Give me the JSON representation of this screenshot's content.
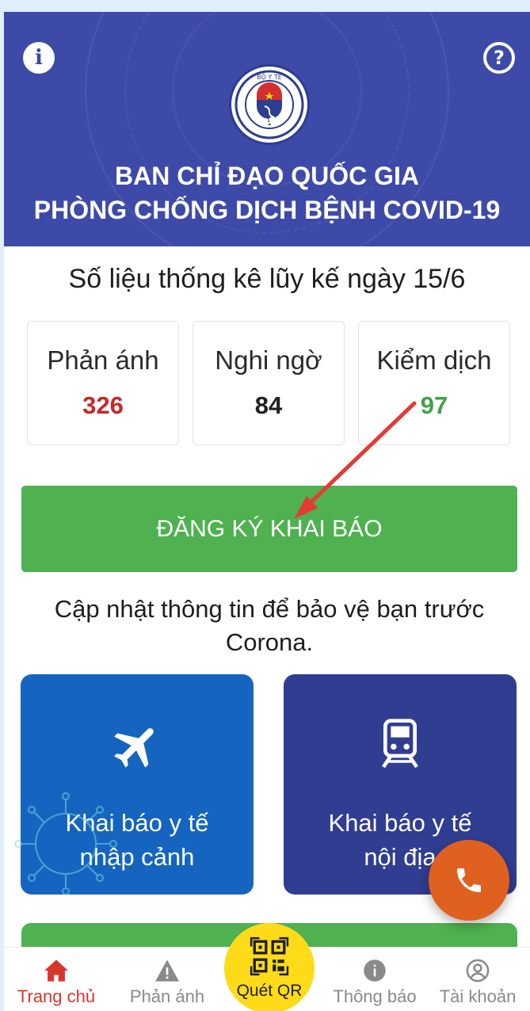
{
  "header": {
    "title_line1": "BAN CHỈ ĐẠO QUỐC GIA",
    "title_line2": "PHÒNG CHỐNG DỊCH BỆNH COVID-19",
    "info_icon": "info-icon",
    "help_icon": "help-icon",
    "logo": {
      "top_text": "BỘ Y TẾ",
      "bottom_text": "MINISTRY OF HEALTH"
    }
  },
  "stats": {
    "title": "Số liệu thống kê lũy kế ngày 15/6",
    "items": [
      {
        "label": "Phản ánh",
        "value": "326",
        "color": "#c62828"
      },
      {
        "label": "Nghi ngờ",
        "value": "84",
        "color": "#212121"
      },
      {
        "label": "Kiểm dịch",
        "value": "97",
        "color": "#43a047"
      }
    ]
  },
  "register_button": {
    "label": "ĐĂNG KÝ KHAI BÁO"
  },
  "update_text": {
    "line1": "Cập nhật thông tin để bảo vệ bạn trước",
    "line2": "Corona."
  },
  "tiles": [
    {
      "line1": "Khai báo y tế",
      "line2": "nhập cảnh",
      "icon": "airplane-icon"
    },
    {
      "line1": "Khai báo y tế",
      "line2": "nội địa",
      "icon": "train-icon"
    }
  ],
  "call_button": {
    "icon": "phone-icon"
  },
  "bottom_nav": {
    "items": [
      {
        "label": "Trang chủ",
        "icon": "home-icon",
        "active": true
      },
      {
        "label": "Phản ánh",
        "icon": "warning-icon"
      },
      {
        "label": "Quét QR",
        "icon": "qr-code-icon"
      },
      {
        "label": "Thông báo",
        "icon": "info-icon"
      },
      {
        "label": "Tài khoản",
        "icon": "account-icon"
      }
    ]
  },
  "colors": {
    "header_bg": "#3d4aa8",
    "primary_green": "#4fb150",
    "tile_intl": "#1565c0",
    "tile_domestic": "#303d91",
    "call_orange": "#e06020",
    "qr_yellow": "#fddb18",
    "active_red": "#d9362b",
    "annotation_arrow": "#e53935"
  }
}
